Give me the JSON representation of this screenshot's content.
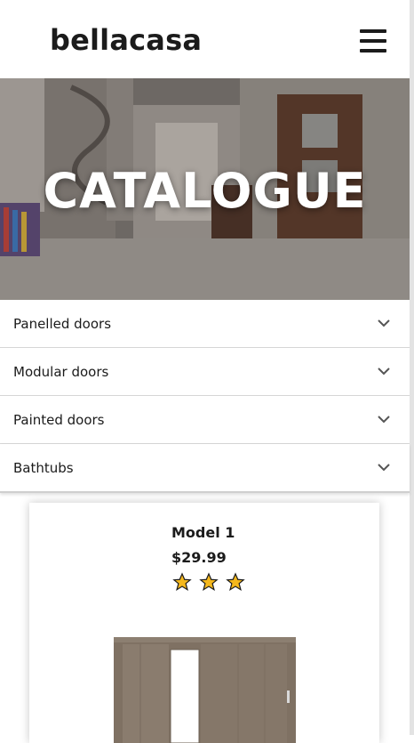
{
  "header": {
    "logo": "bellacasa",
    "menu_icon": "hamburger-menu-icon"
  },
  "hero": {
    "title": "CATALOGUE"
  },
  "accordion": {
    "items": [
      {
        "label": "Panelled doors",
        "icon": "chevron-down-icon"
      },
      {
        "label": "Modular doors",
        "icon": "chevron-down-icon"
      },
      {
        "label": "Painted doors",
        "icon": "chevron-down-icon"
      },
      {
        "label": "Bathtubs",
        "icon": "chevron-down-icon"
      }
    ]
  },
  "product": {
    "title": "Model 1",
    "price": "$29.99",
    "rating": 3,
    "rating_max": 3
  },
  "colors": {
    "star": "#f5b81c",
    "text": "#1b1b1b",
    "divider": "#d6d6d6"
  }
}
